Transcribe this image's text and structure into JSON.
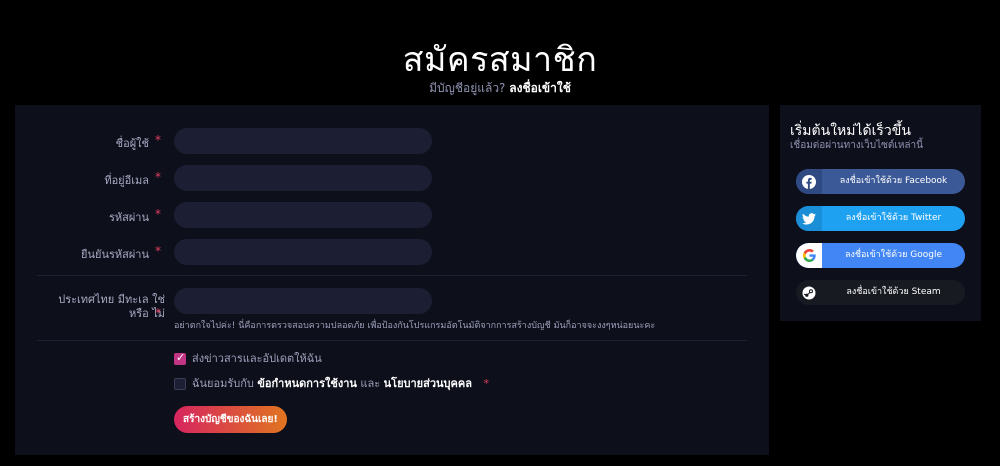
{
  "header": {
    "title": "สมัครสมาชิก",
    "have_account_text": "มีบัญชีอยู่แล้ว?",
    "login_link": "ลงชื่อเข้าใช้"
  },
  "form": {
    "fields": [
      {
        "label": "ชื่อผู้ใช้",
        "required_mark": "*",
        "value": "",
        "placeholder": ""
      },
      {
        "label": "ที่อยู่อีเมล",
        "required_mark": "*",
        "value": "",
        "placeholder": ""
      },
      {
        "label": "รหัสผ่าน",
        "required_mark": "*",
        "value": "",
        "placeholder": ""
      },
      {
        "label": "ยืนยันรหัสผ่าน",
        "required_mark": "*",
        "value": "",
        "placeholder": ""
      }
    ],
    "captcha": {
      "label": "ประเทศไทย มีทะเล ใช่ หรือ ไม่",
      "required_mark": "*",
      "value": "",
      "hint": "อย่าตกใจไปค่ะ! นี่คือการตรวจสอบความปลอดภัย เพื่อป้องกันโปรแกรมอัตโนมัติจากการสร้างบัญชี มันก็อาจจะงงๆหน่อยนะคะ"
    },
    "newsletter": {
      "label": "ส่งข่าวสารและอัปเดตให้ฉัน",
      "checked": true
    },
    "terms": {
      "prefix": "ฉันยอมรับกับ",
      "terms_link": "ข้อกำหนดการใช้งาน",
      "and_text": "และ",
      "privacy_link": "นโยบายส่วนบุคคล",
      "required_mark": "*",
      "checked": false
    },
    "submit_label": "สร้างบัญชีของฉันเลย!"
  },
  "sidebar": {
    "title": "เริ่มต้นใหม่ได้เร็วขึ้น",
    "subtitle": "เชื่อมต่อผ่านทางเว็บไซต์เหล่านี้",
    "buttons": [
      {
        "label": "ลงชื่อเข้าใช้ด้วย Facebook",
        "icon": "facebook-icon",
        "color": "#3b5997"
      },
      {
        "label": "ลงชื่อเข้าใช้ด้วย Twitter",
        "icon": "twitter-icon",
        "color": "#1fa1f2"
      },
      {
        "label": "ลงชื่อเข้าใช้ด้วย Google",
        "icon": "google-icon",
        "color": "#4285f4"
      },
      {
        "label": "ลงชื่อเข้าใช้ด้วย Steam",
        "icon": "steam-icon",
        "color": "#171a21"
      }
    ]
  },
  "colors": {
    "background": "#000000",
    "panel": "#0d0f1b",
    "input": "#1c1f33",
    "required": "#e04060",
    "accent_checkbox": "#c13584",
    "submit_gradient_start": "#d6255f",
    "submit_gradient_end": "#e07520"
  }
}
